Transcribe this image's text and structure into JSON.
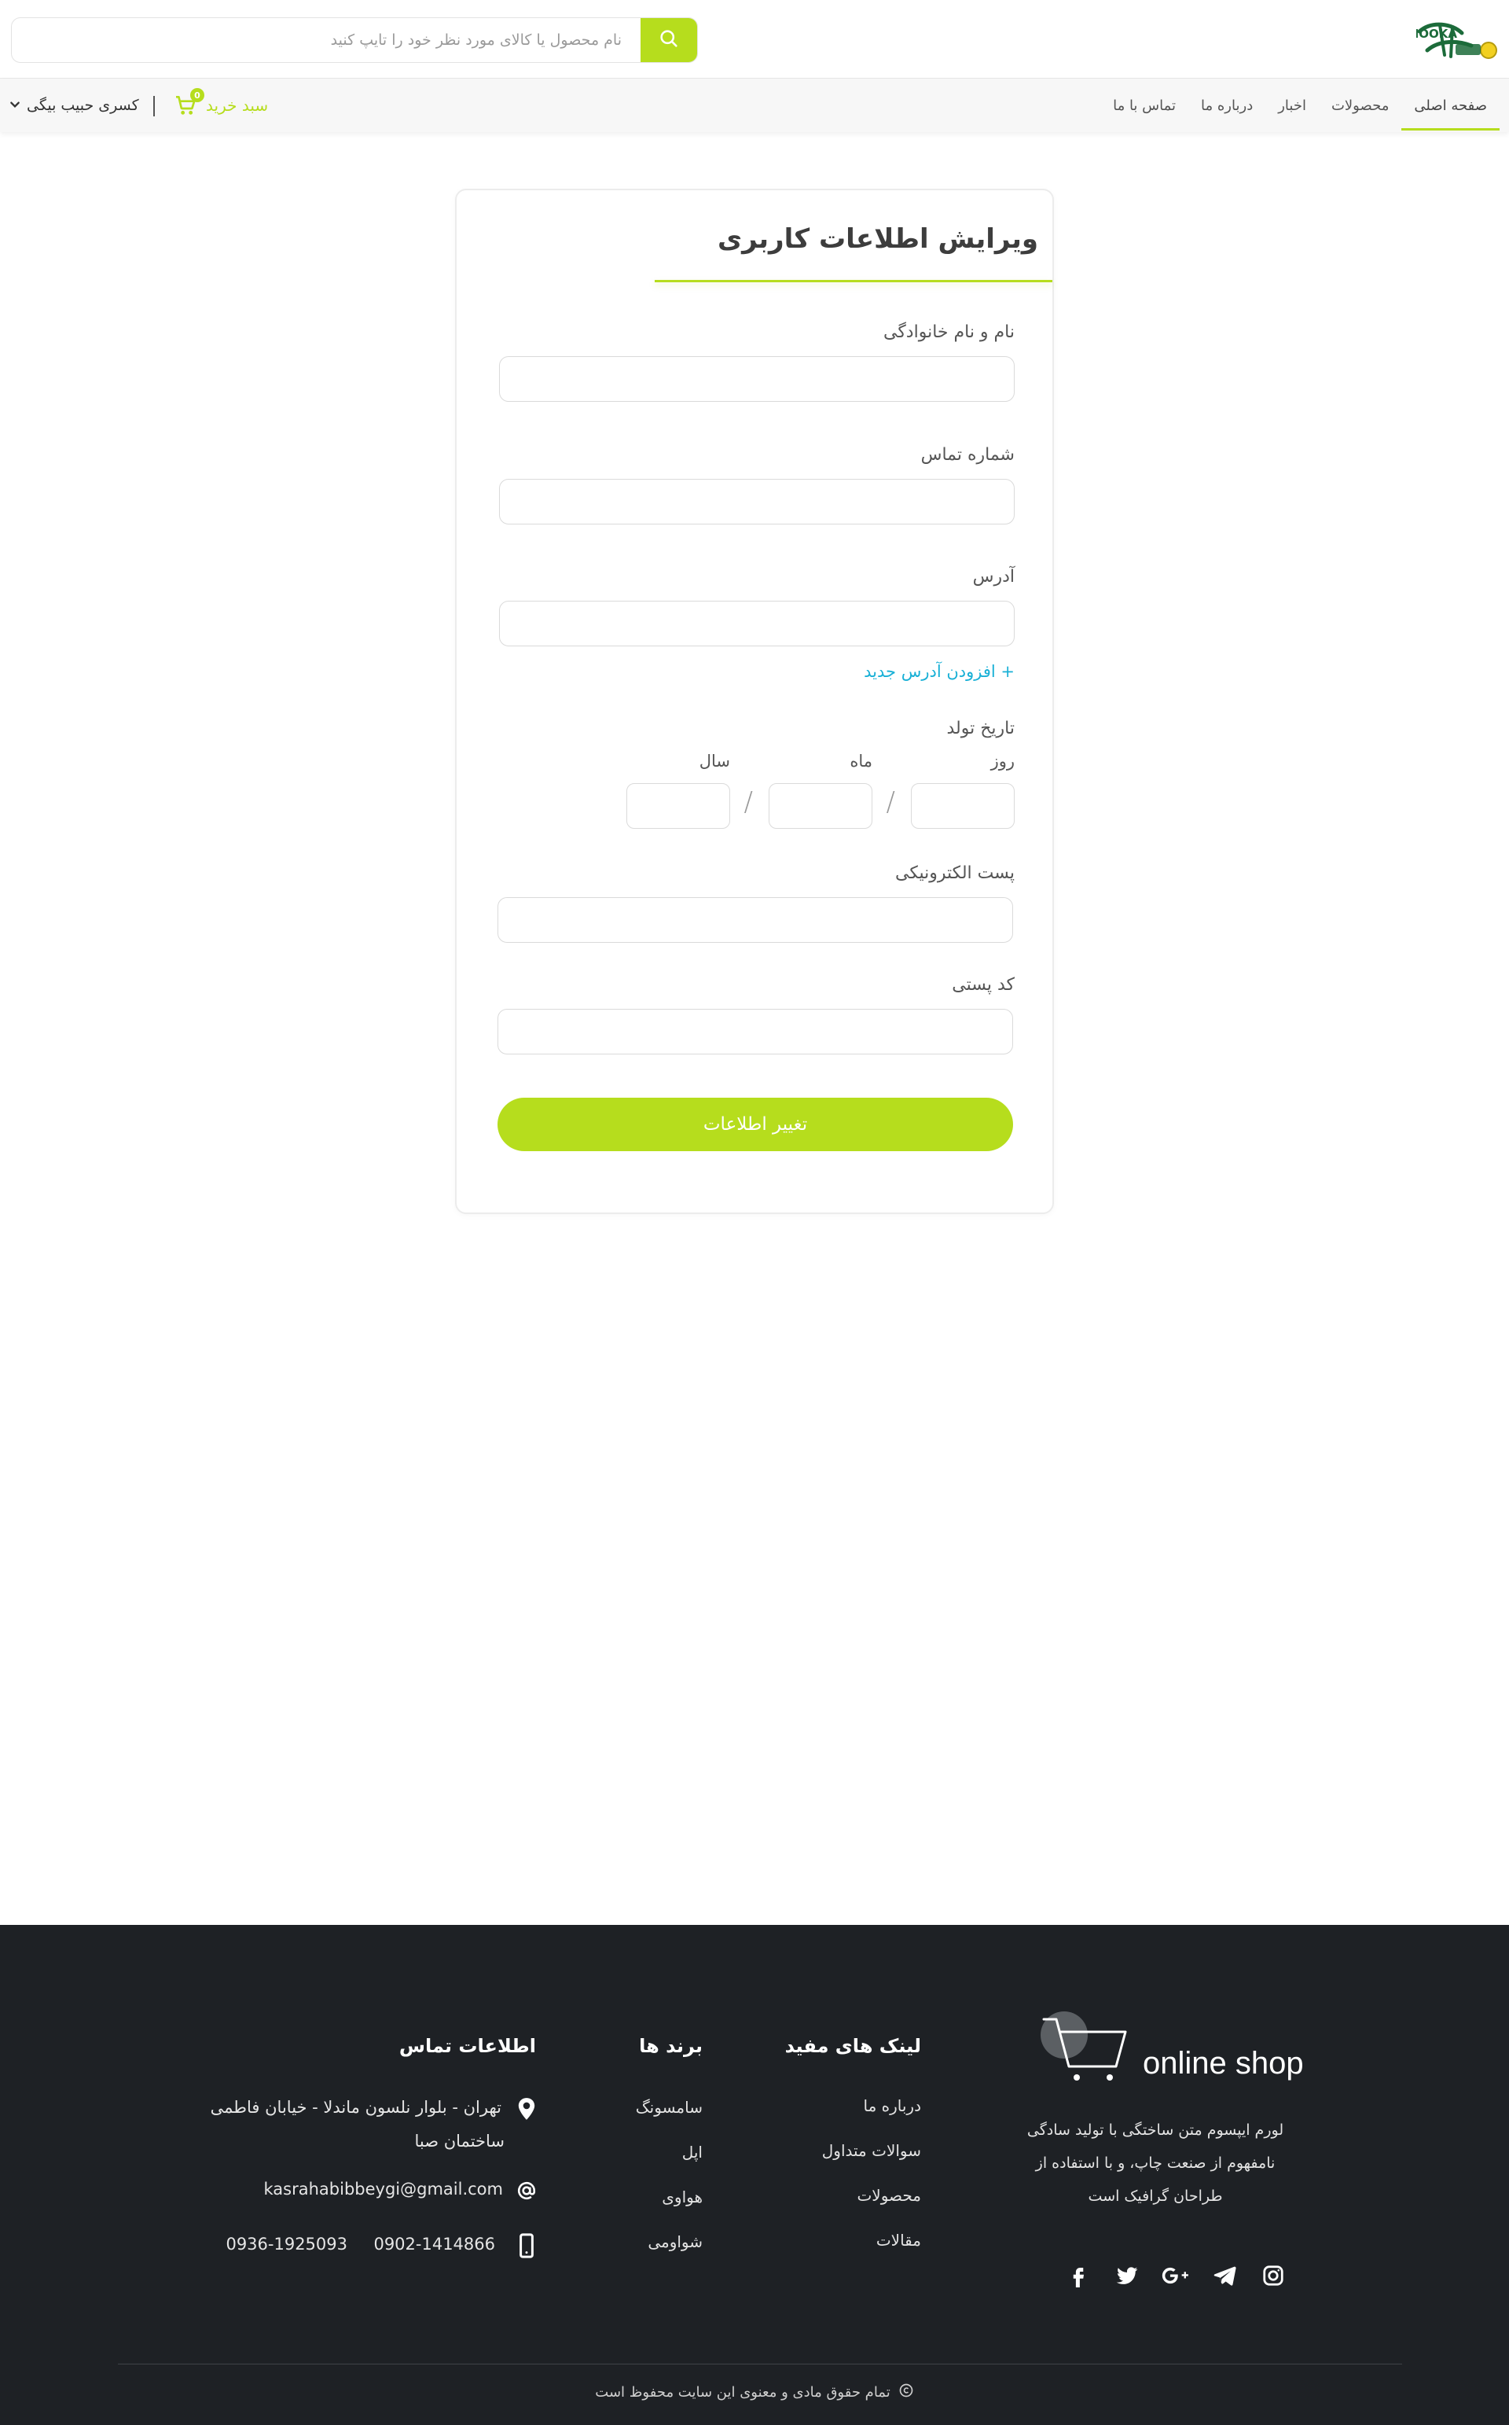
{
  "header": {
    "logo_alt": "فروشگاه اینترنتی لیموکا",
    "search_placeholder": "نام محصول یا کالای مورد نظر خود را تایپ کنید"
  },
  "nav": {
    "items": [
      {
        "label": "صفحه اصلی",
        "active": true
      },
      {
        "label": "محصولات"
      },
      {
        "label": "اخبار"
      },
      {
        "label": "درباره ما"
      },
      {
        "label": "تماس با ما"
      }
    ],
    "cart_label": "سبد خرید",
    "cart_count": "0",
    "user_name": "کسری حبیب بیگی"
  },
  "form": {
    "title": "ویرایش اطلاعات کاربری",
    "full_name_label": "نام و نام خانوادگی",
    "phone_label": "شماره تماس",
    "address_label": "آدرس",
    "add_address_link": "+ افزودن آدرس جدید",
    "birthdate_label": "تاریخ تولد",
    "day_label": "روز",
    "month_label": "ماه",
    "year_label": "سال",
    "date_separator": "/",
    "email_label": "پست الکترونیکی",
    "postal_code_label": "کد پستی",
    "submit_label": "تغییر اطلاعات"
  },
  "footer": {
    "brand_name": "online shop",
    "brand_description": "لورم ایپسوم متن ساختگی با تولید سادگی نامفهوم از صنعت چاپ، و با استفاده از طراحان گرافیک است",
    "useful_links_title": "لینک های مفید",
    "useful_links": [
      "درباره ما",
      "سوالات متداول",
      "محصولات",
      "مقالات"
    ],
    "brands_title": "برند ها",
    "brands": [
      "سامسونگ",
      "اپل",
      "هواوی",
      "شواومی"
    ],
    "contact_title": "اطلاعات تماس",
    "address_line1": "تهران - بلوار نلسون ماندلا - خیابان فاطمی",
    "address_line2": "ساختمان صبا",
    "email": "kasrahabibbeygi@gmail.com",
    "phone1": "0902-1414866",
    "phone2": "0936-1925093",
    "copyright": "تمام حقوق مادی و معنوی این سایت محفوظ است",
    "socials": [
      "facebook-icon",
      "twitter-icon",
      "google-plus-icon",
      "telegram-icon",
      "instagram-icon"
    ]
  },
  "colors": {
    "accent": "#b6dd1d",
    "link": "#19b0d6",
    "footer_bg": "#1e2125"
  }
}
